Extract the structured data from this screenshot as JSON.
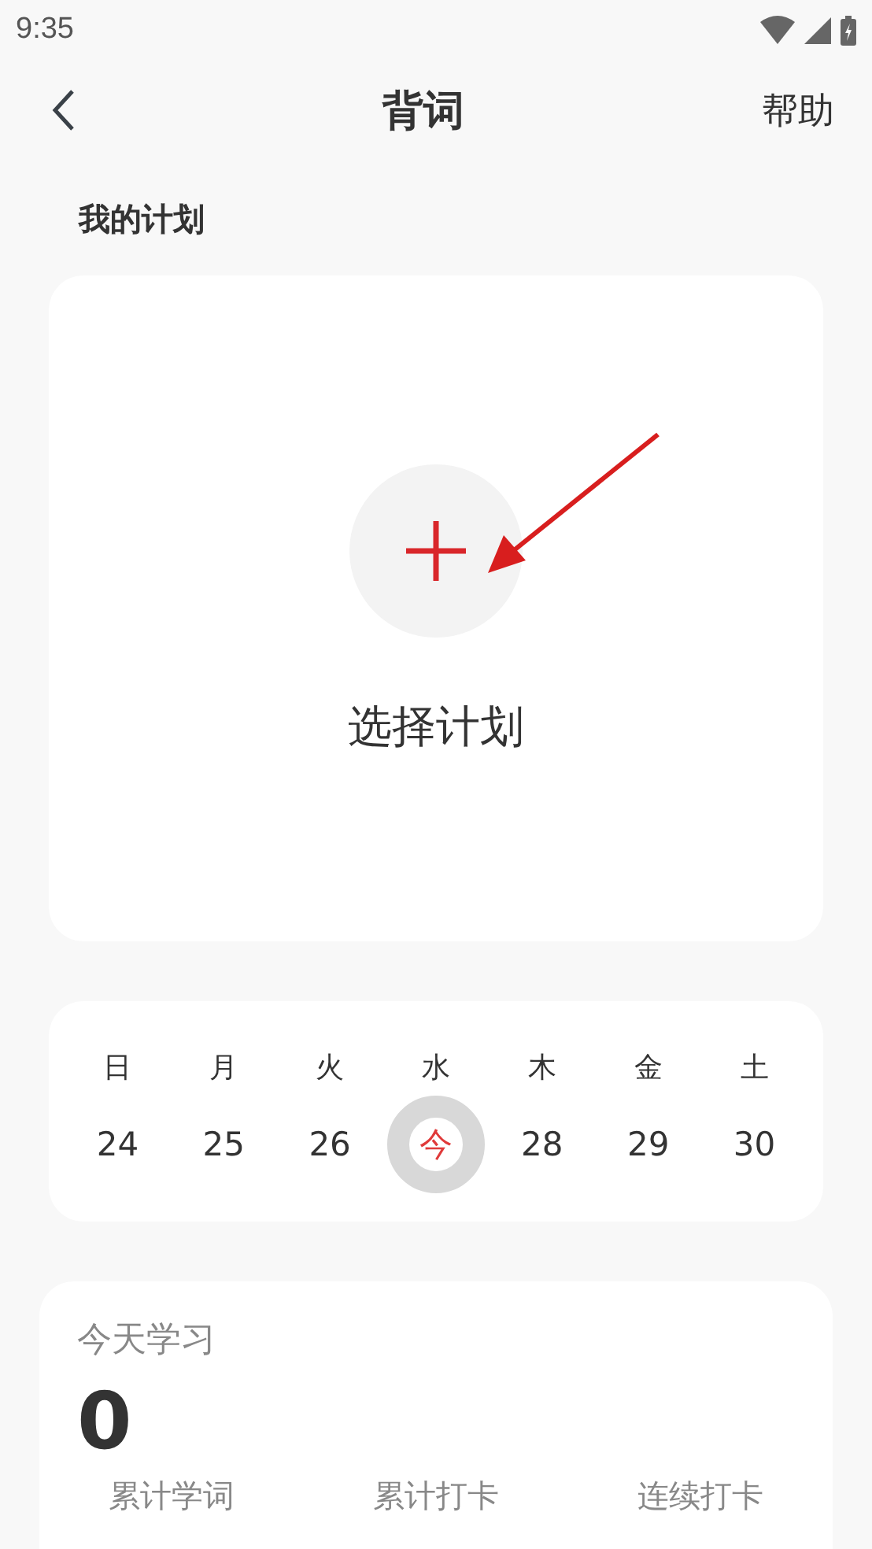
{
  "status_bar": {
    "time": "9:35"
  },
  "header": {
    "title": "背词",
    "action": "帮助"
  },
  "plan": {
    "section_title": "我的计划",
    "add_label": "选择计划"
  },
  "week": [
    {
      "weekday": "日",
      "date": "24",
      "selected": false
    },
    {
      "weekday": "月",
      "date": "25",
      "selected": false
    },
    {
      "weekday": "火",
      "date": "26",
      "selected": false
    },
    {
      "weekday": "水",
      "date": "今",
      "selected": true
    },
    {
      "weekday": "木",
      "date": "28",
      "selected": false
    },
    {
      "weekday": "金",
      "date": "29",
      "selected": false
    },
    {
      "weekday": "土",
      "date": "30",
      "selected": false
    }
  ],
  "today": {
    "title": "今天学习",
    "count": "0",
    "stats": [
      "累计学词",
      "累计打卡",
      "连续打卡"
    ]
  }
}
